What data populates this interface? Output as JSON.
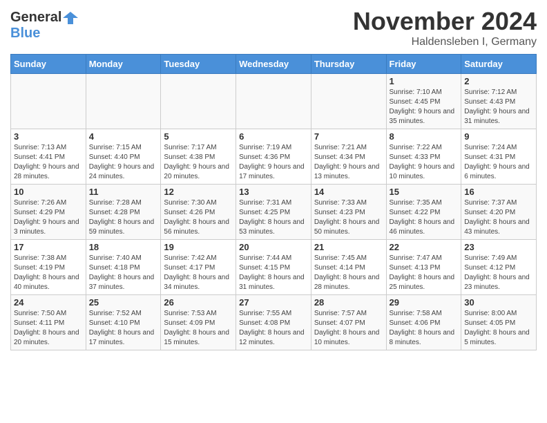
{
  "header": {
    "logo_line1": "General",
    "logo_line2": "Blue",
    "month": "November 2024",
    "location": "Haldensleben I, Germany"
  },
  "weekdays": [
    "Sunday",
    "Monday",
    "Tuesday",
    "Wednesday",
    "Thursday",
    "Friday",
    "Saturday"
  ],
  "weeks": [
    [
      {
        "day": "",
        "info": ""
      },
      {
        "day": "",
        "info": ""
      },
      {
        "day": "",
        "info": ""
      },
      {
        "day": "",
        "info": ""
      },
      {
        "day": "",
        "info": ""
      },
      {
        "day": "1",
        "info": "Sunrise: 7:10 AM\nSunset: 4:45 PM\nDaylight: 9 hours and 35 minutes."
      },
      {
        "day": "2",
        "info": "Sunrise: 7:12 AM\nSunset: 4:43 PM\nDaylight: 9 hours and 31 minutes."
      }
    ],
    [
      {
        "day": "3",
        "info": "Sunrise: 7:13 AM\nSunset: 4:41 PM\nDaylight: 9 hours and 28 minutes."
      },
      {
        "day": "4",
        "info": "Sunrise: 7:15 AM\nSunset: 4:40 PM\nDaylight: 9 hours and 24 minutes."
      },
      {
        "day": "5",
        "info": "Sunrise: 7:17 AM\nSunset: 4:38 PM\nDaylight: 9 hours and 20 minutes."
      },
      {
        "day": "6",
        "info": "Sunrise: 7:19 AM\nSunset: 4:36 PM\nDaylight: 9 hours and 17 minutes."
      },
      {
        "day": "7",
        "info": "Sunrise: 7:21 AM\nSunset: 4:34 PM\nDaylight: 9 hours and 13 minutes."
      },
      {
        "day": "8",
        "info": "Sunrise: 7:22 AM\nSunset: 4:33 PM\nDaylight: 9 hours and 10 minutes."
      },
      {
        "day": "9",
        "info": "Sunrise: 7:24 AM\nSunset: 4:31 PM\nDaylight: 9 hours and 6 minutes."
      }
    ],
    [
      {
        "day": "10",
        "info": "Sunrise: 7:26 AM\nSunset: 4:29 PM\nDaylight: 9 hours and 3 minutes."
      },
      {
        "day": "11",
        "info": "Sunrise: 7:28 AM\nSunset: 4:28 PM\nDaylight: 8 hours and 59 minutes."
      },
      {
        "day": "12",
        "info": "Sunrise: 7:30 AM\nSunset: 4:26 PM\nDaylight: 8 hours and 56 minutes."
      },
      {
        "day": "13",
        "info": "Sunrise: 7:31 AM\nSunset: 4:25 PM\nDaylight: 8 hours and 53 minutes."
      },
      {
        "day": "14",
        "info": "Sunrise: 7:33 AM\nSunset: 4:23 PM\nDaylight: 8 hours and 50 minutes."
      },
      {
        "day": "15",
        "info": "Sunrise: 7:35 AM\nSunset: 4:22 PM\nDaylight: 8 hours and 46 minutes."
      },
      {
        "day": "16",
        "info": "Sunrise: 7:37 AM\nSunset: 4:20 PM\nDaylight: 8 hours and 43 minutes."
      }
    ],
    [
      {
        "day": "17",
        "info": "Sunrise: 7:38 AM\nSunset: 4:19 PM\nDaylight: 8 hours and 40 minutes."
      },
      {
        "day": "18",
        "info": "Sunrise: 7:40 AM\nSunset: 4:18 PM\nDaylight: 8 hours and 37 minutes."
      },
      {
        "day": "19",
        "info": "Sunrise: 7:42 AM\nSunset: 4:17 PM\nDaylight: 8 hours and 34 minutes."
      },
      {
        "day": "20",
        "info": "Sunrise: 7:44 AM\nSunset: 4:15 PM\nDaylight: 8 hours and 31 minutes."
      },
      {
        "day": "21",
        "info": "Sunrise: 7:45 AM\nSunset: 4:14 PM\nDaylight: 8 hours and 28 minutes."
      },
      {
        "day": "22",
        "info": "Sunrise: 7:47 AM\nSunset: 4:13 PM\nDaylight: 8 hours and 25 minutes."
      },
      {
        "day": "23",
        "info": "Sunrise: 7:49 AM\nSunset: 4:12 PM\nDaylight: 8 hours and 23 minutes."
      }
    ],
    [
      {
        "day": "24",
        "info": "Sunrise: 7:50 AM\nSunset: 4:11 PM\nDaylight: 8 hours and 20 minutes."
      },
      {
        "day": "25",
        "info": "Sunrise: 7:52 AM\nSunset: 4:10 PM\nDaylight: 8 hours and 17 minutes."
      },
      {
        "day": "26",
        "info": "Sunrise: 7:53 AM\nSunset: 4:09 PM\nDaylight: 8 hours and 15 minutes."
      },
      {
        "day": "27",
        "info": "Sunrise: 7:55 AM\nSunset: 4:08 PM\nDaylight: 8 hours and 12 minutes."
      },
      {
        "day": "28",
        "info": "Sunrise: 7:57 AM\nSunset: 4:07 PM\nDaylight: 8 hours and 10 minutes."
      },
      {
        "day": "29",
        "info": "Sunrise: 7:58 AM\nSunset: 4:06 PM\nDaylight: 8 hours and 8 minutes."
      },
      {
        "day": "30",
        "info": "Sunrise: 8:00 AM\nSunset: 4:05 PM\nDaylight: 8 hours and 5 minutes."
      }
    ]
  ]
}
